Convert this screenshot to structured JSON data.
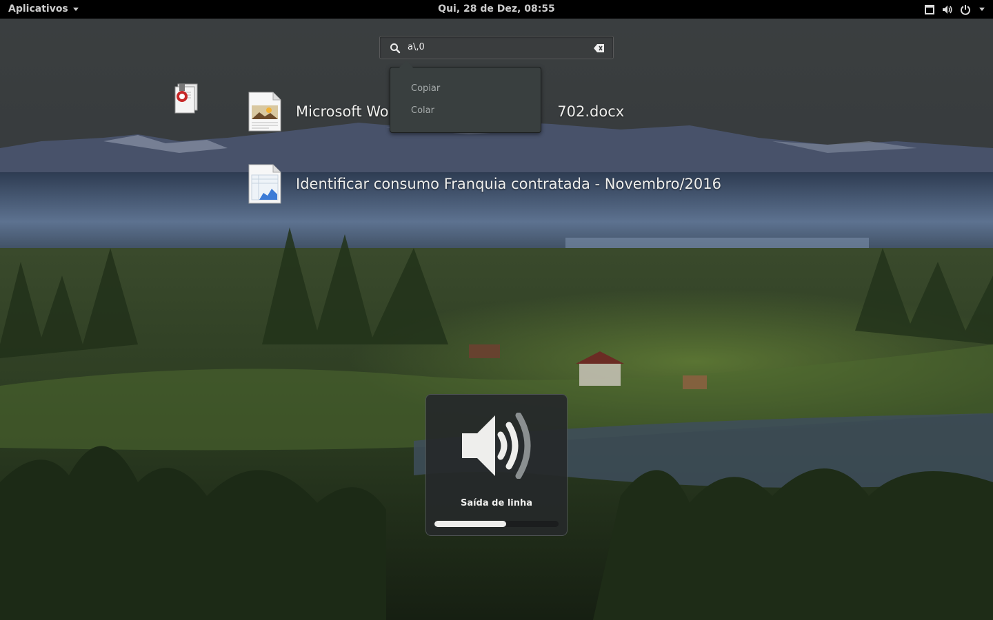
{
  "topbar": {
    "apps_label": "Aplicativos",
    "clock": "Qui, 28 de Dez, 08:55",
    "status_icons": [
      "window-icon",
      "volume-icon",
      "power-icon",
      "caret-down-icon"
    ]
  },
  "search": {
    "value": "a\\,0"
  },
  "context_menu": {
    "items": [
      {
        "label": "Copiar"
      },
      {
        "label": "Colar"
      }
    ]
  },
  "results": [
    {
      "title": "Microsoft Wor",
      "title_tail": "702.docx",
      "icon": "document-icon"
    },
    {
      "title": "Identificar consumo Franquia contratada - Novembro/2016",
      "icon": "spreadsheet-icon"
    }
  ],
  "osd": {
    "label": "Saída de linha",
    "level": 0.58
  },
  "colors": {
    "topbar_bg": "#000000",
    "osd_bg": "#26292a",
    "menu_bg": "#393f3f"
  }
}
